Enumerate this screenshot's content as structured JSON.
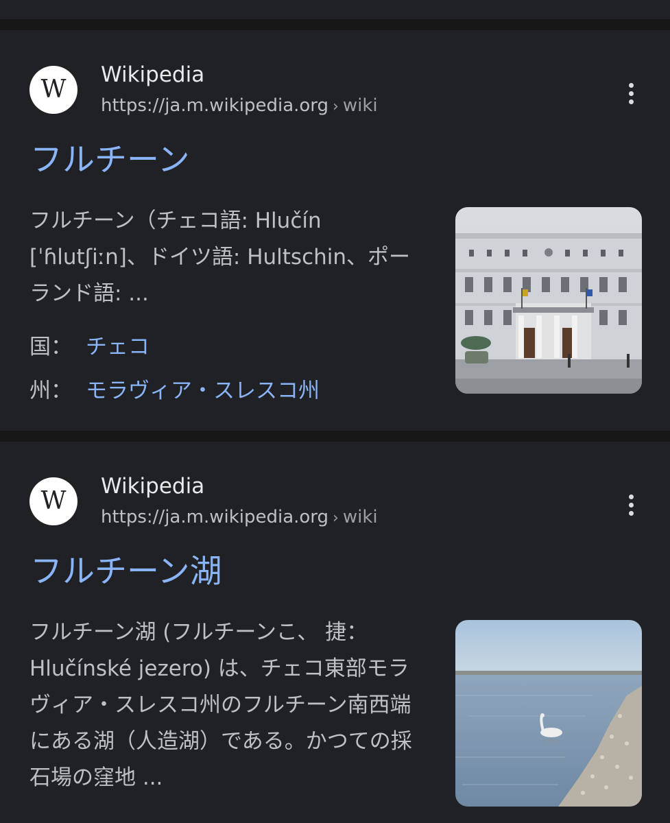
{
  "results": [
    {
      "favicon_letter": "W",
      "site_name": "Wikipedia",
      "url": "https://ja.m.wikipedia.org",
      "url_separator": "›",
      "url_crumb": "wiki",
      "title": "フルチーン",
      "snippet": "フルチーン（チェコ語: Hlučín [ˈɦlutʃiːn]、ドイツ語: Hultschin、ポーランド語: ...",
      "facts": [
        {
          "label": "国：",
          "value": "チェコ"
        },
        {
          "label": "州：",
          "value": "モラヴィア・スレスコ州"
        }
      ],
      "thumbnail": "town-hall-photo"
    },
    {
      "favicon_letter": "W",
      "site_name": "Wikipedia",
      "url": "https://ja.m.wikipedia.org",
      "url_separator": "›",
      "url_crumb": "wiki",
      "title": "フルチーン湖",
      "snippet": "フルチーン湖 (フルチーンこ、 捷：Hlučínské jezero) は、チェコ東部モラヴィア・スレスコ州のフルチーン南西端にある湖（人造湖）である。かつての採石場の窪地 ...",
      "thumbnail": "lake-swan-photo"
    }
  ],
  "colors": {
    "background": "#202124",
    "separator": "#171717",
    "link": "#8ab4f8",
    "text_primary": "#e8eaed",
    "text_secondary": "#bdc1c6"
  }
}
